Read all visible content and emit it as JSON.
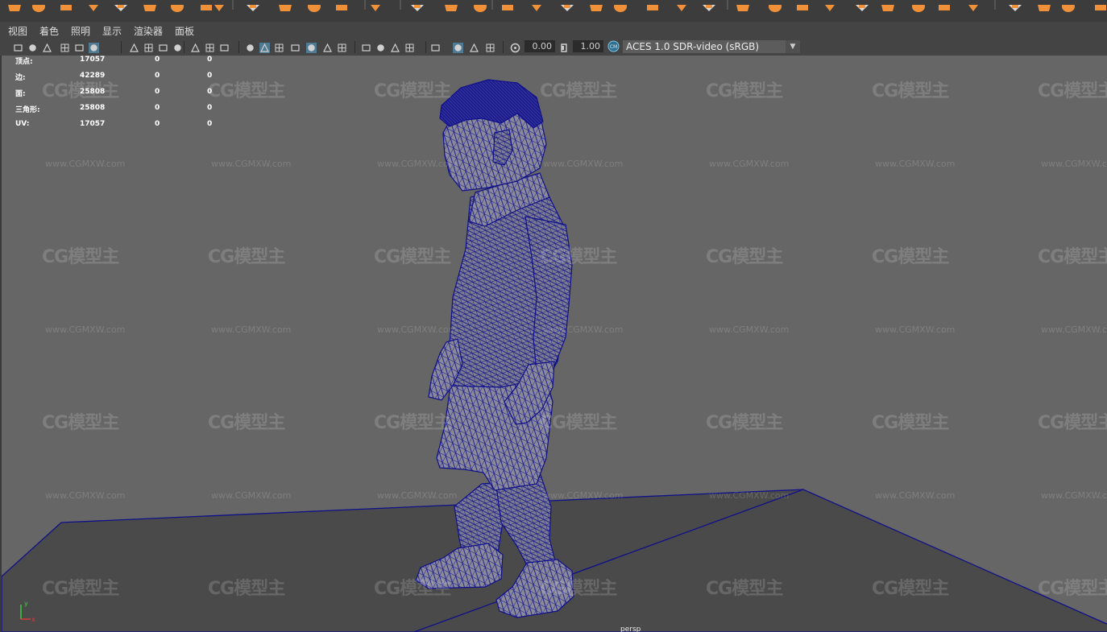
{
  "shelf": {
    "icons": [
      "polygon-cube-icon",
      "polygon-sphere-icon",
      "polygon-cylinder-icon",
      "polygon-cone-icon",
      "polygon-torus-icon",
      "polygon-plane-icon",
      "polygon-disc-icon",
      "polygon-pyramid-icon",
      "combine-icon",
      "separate-icon",
      "extract-icon",
      "bevel-icon",
      "bridge-icon",
      "extrude-icon",
      "multi-cut-icon",
      "target-weld-icon",
      "mirror-icon",
      "smooth-icon",
      "uv-editor-icon",
      "create-uvs-icon",
      "unfold-icon",
      "layout-icon",
      "cut-uv-icon",
      "sew-uv-icon",
      "transfer-icon",
      "history-icon"
    ],
    "colors": {
      "icon_orange": "#f0913a",
      "bg": "#3c3c3c",
      "green_frame": "#3ec83e"
    }
  },
  "menu": {
    "items": [
      "视图",
      "着色",
      "照明",
      "显示",
      "渲染器",
      "面板"
    ]
  },
  "panel_toolbar": {
    "icons": [
      "select-camera-icon",
      "camera-attributes-icon",
      "bookmark-icon",
      "image-plane-icon",
      "two-d-pan-icon",
      "grease-pencil-icon",
      "grid-icon",
      "film-gate-icon",
      "resolution-gate-icon",
      "gate-mask-icon",
      "field-chart-icon",
      "safe-action-icon",
      "safe-title-icon",
      "wireframe-icon",
      "smooth-shade-icon",
      "default-material-icon",
      "textured-icon",
      "wireframe-on-shaded-icon",
      "use-all-lights-icon",
      "shadows-icon",
      "screen-space-ao-icon",
      "motion-blur-icon",
      "multisample-aa-icon",
      "depth-of-field-icon",
      "isolate-select-icon",
      "xray-icon",
      "xray-joints-icon",
      "xray-components-icon",
      "exposure-icon",
      "gamma-icon",
      "color-management-icon"
    ],
    "exposure_value": "0.00",
    "gamma_value": "1.00",
    "color_management": "ACES 1.0 SDR-video (sRGB)",
    "colors": {
      "active_icon": "#58a8d6",
      "field_bg": "#2b2b2b"
    }
  },
  "hud": {
    "rows": [
      {
        "label": "顶点:",
        "value": "17057",
        "selected": "0",
        "uv": "0"
      },
      {
        "label": "边:",
        "value": "42289",
        "selected": "0",
        "uv": "0"
      },
      {
        "label": "面:",
        "value": "25808",
        "selected": "0",
        "uv": "0"
      },
      {
        "label": "三角形:",
        "value": "25808",
        "selected": "0",
        "uv": "0"
      },
      {
        "label": "UV:",
        "value": "17057",
        "selected": "0",
        "uv": "0"
      }
    ]
  },
  "viewport": {
    "camera": "persp",
    "axis": {
      "x": "x",
      "y": "y"
    },
    "background": "#666666",
    "ground_color": "#4a4a4a",
    "wire_color": "#10108a"
  },
  "watermark": {
    "logo": "CG模型主",
    "url": "www.CGMXW.com"
  }
}
